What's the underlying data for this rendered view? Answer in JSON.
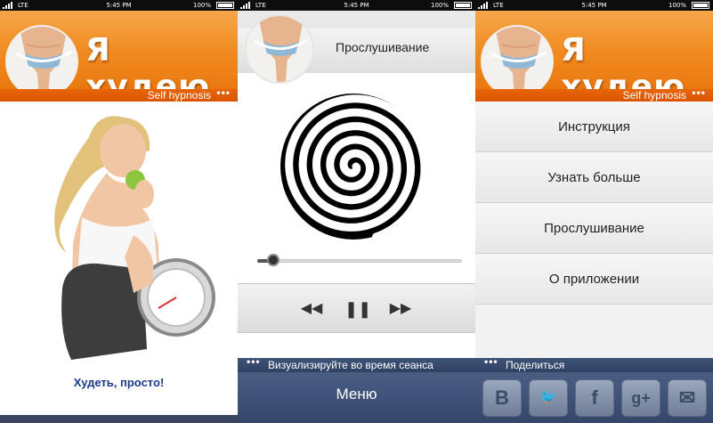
{
  "status_bar": {
    "network": "LTE",
    "time": "5:45 PM",
    "battery": "100%"
  },
  "brand": {
    "title": "Я худею",
    "subtitle": "Self hypnosis",
    "more_dots": "•••"
  },
  "screen1": {
    "tagline": "Худеть, просто!"
  },
  "player": {
    "title": "Прослушивание",
    "progress": 0.08,
    "controls": {
      "rewind": "◀◀",
      "pause": "❚❚",
      "forward": "▶▶"
    },
    "hint": "Визуализируйте во время сеанса",
    "menu_label": "Меню"
  },
  "menu": {
    "items": [
      {
        "label": "Инструкция"
      },
      {
        "label": "Узнать больше"
      },
      {
        "label": "Прослушивание"
      },
      {
        "label": "О приложении"
      }
    ],
    "share_label": "Поделиться",
    "social": [
      {
        "icon": "vk-icon",
        "glyph": "B"
      },
      {
        "icon": "twitter-icon",
        "glyph": "🐦"
      },
      {
        "icon": "facebook-icon",
        "glyph": "f"
      },
      {
        "icon": "google-plus-icon",
        "glyph": "g+"
      },
      {
        "icon": "mail-icon",
        "glyph": "✉"
      }
    ]
  },
  "colors": {
    "orange": "#f08a1f",
    "navy": "#34466a",
    "tagline": "#1c3a8a"
  }
}
